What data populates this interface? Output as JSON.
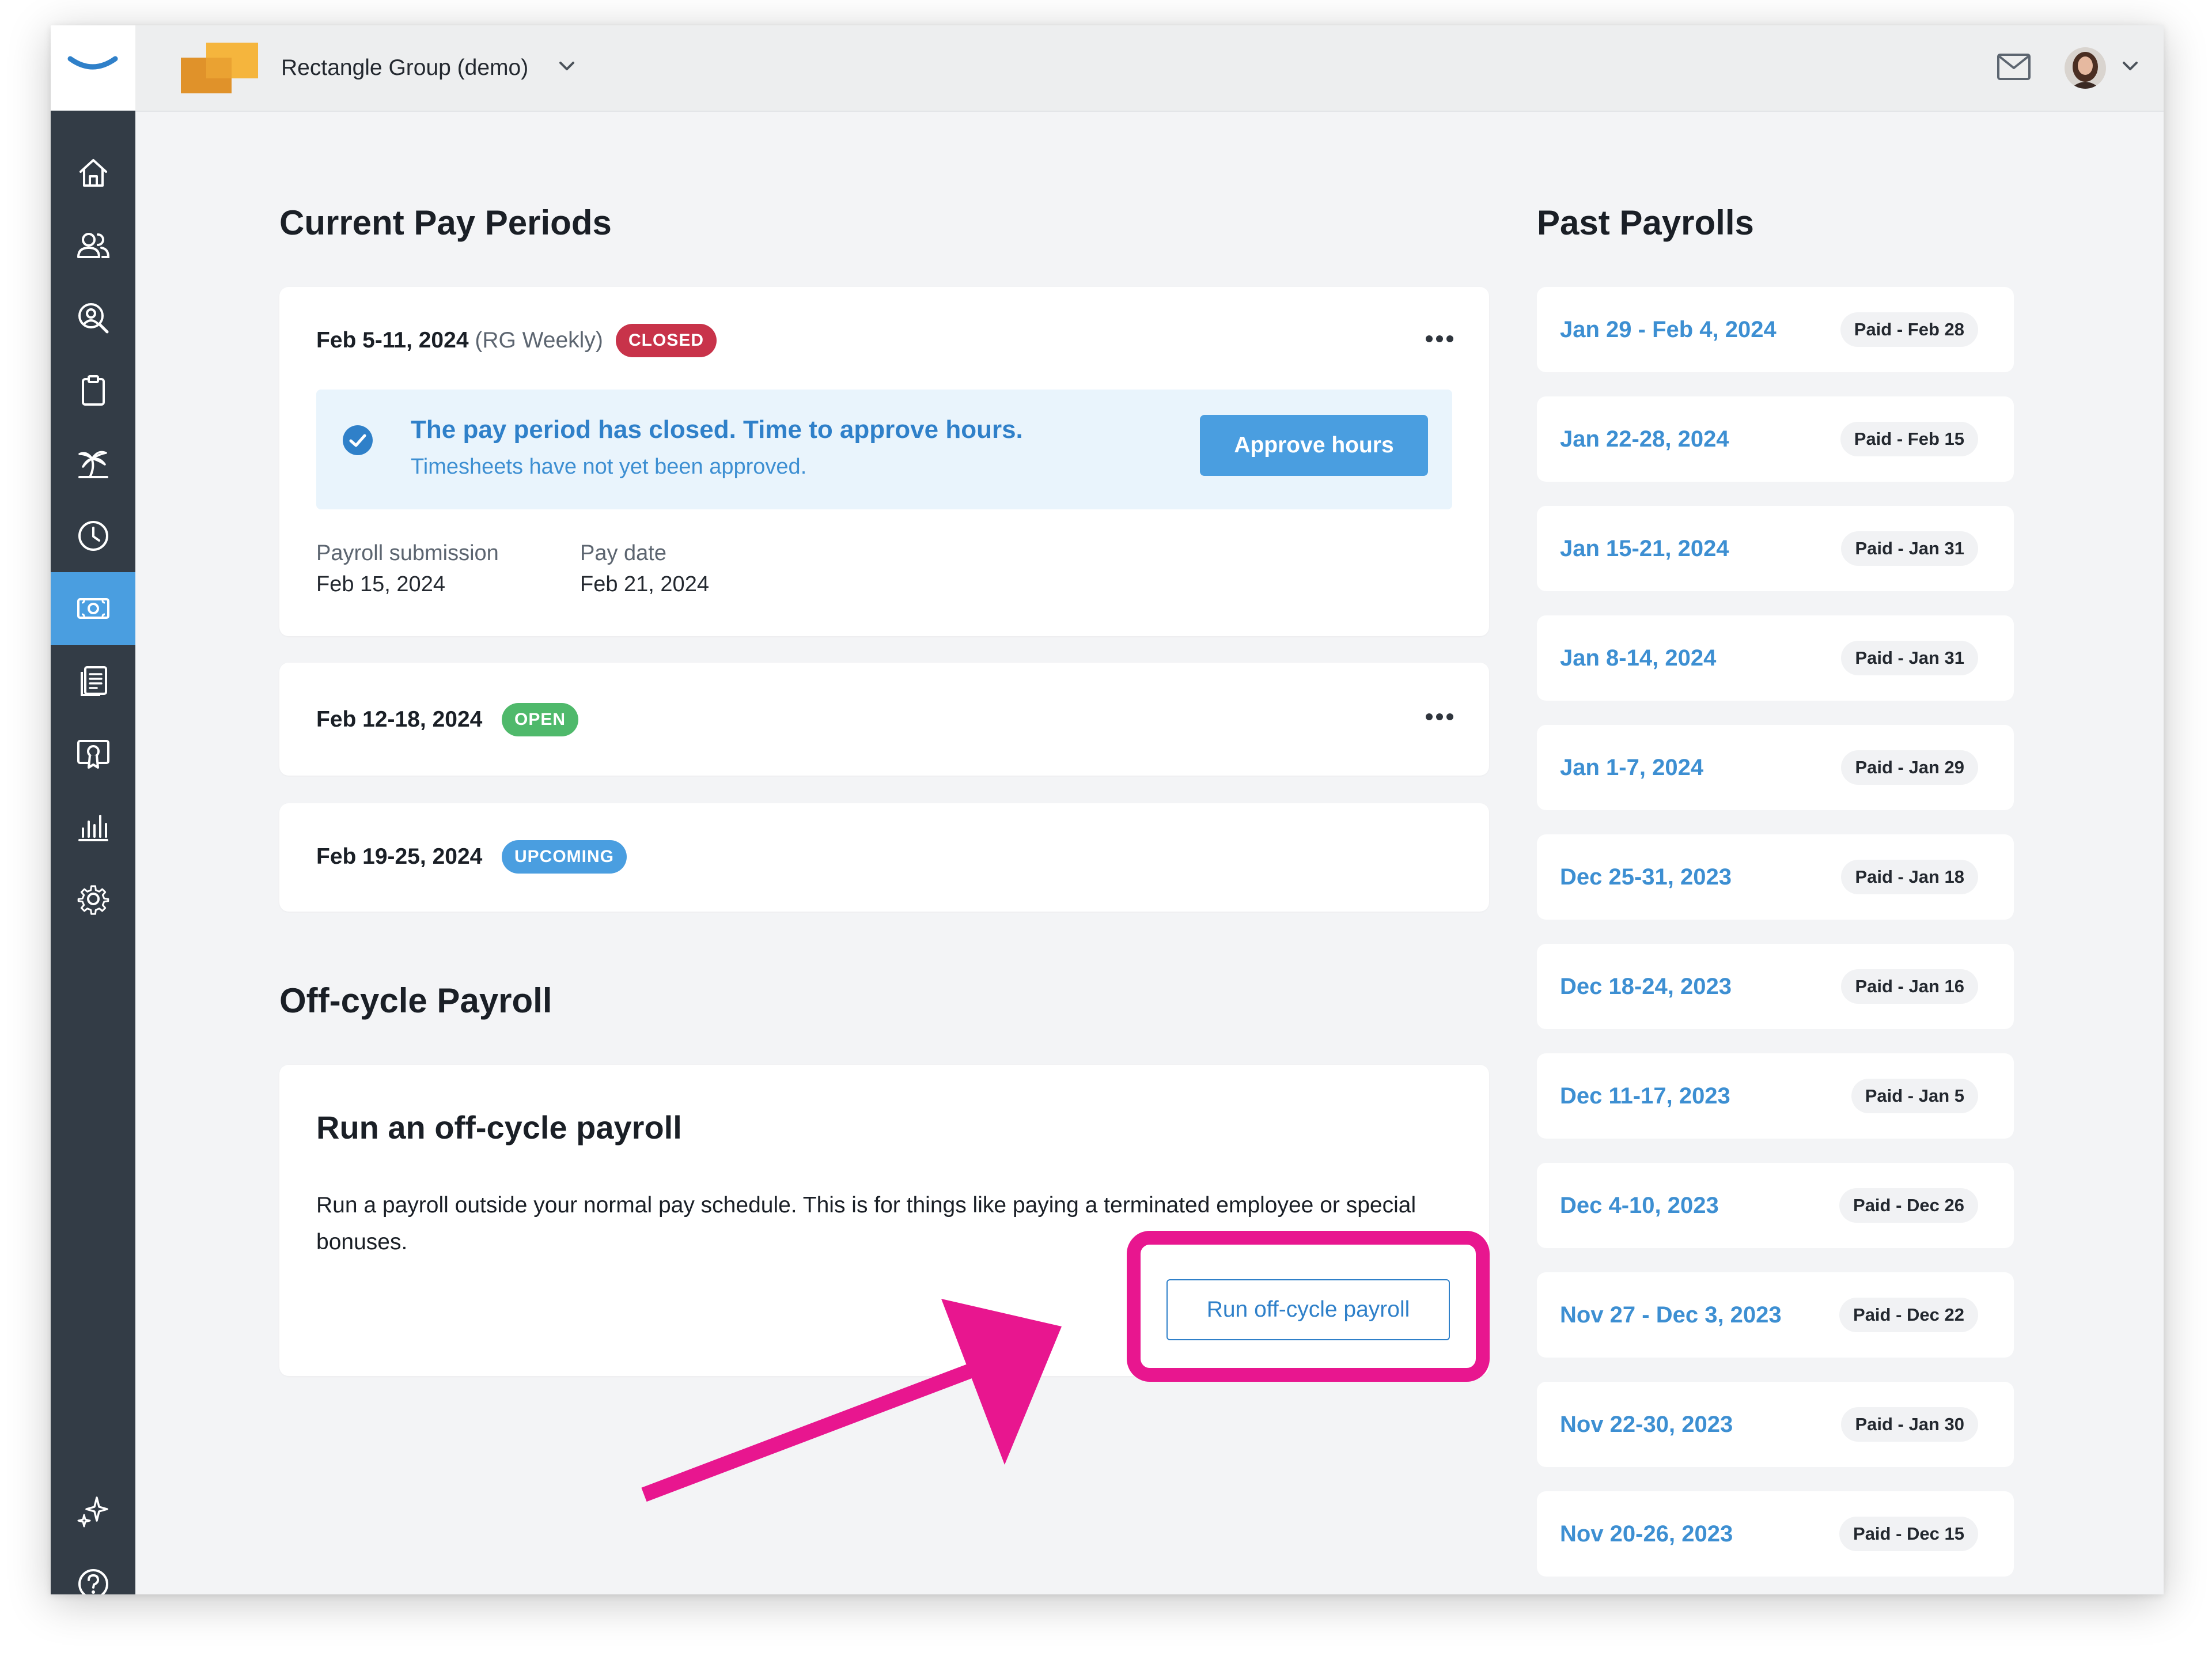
{
  "org": {
    "name": "Rectangle Group (demo)"
  },
  "colors": {
    "accent": "#4a9ee0",
    "link": "#3d8fd2",
    "closed": "#c8334a",
    "open": "#4fb96b",
    "upcoming": "#4a9ee0",
    "highlight": "#e8168f",
    "sidebar": "#333c46"
  },
  "sidebar": {
    "items": [
      {
        "icon": "home-icon"
      },
      {
        "icon": "people-icon"
      },
      {
        "icon": "person-search-icon"
      },
      {
        "icon": "clipboard-icon"
      },
      {
        "icon": "palm-tree-icon"
      },
      {
        "icon": "clock-icon"
      },
      {
        "icon": "payroll-money-icon",
        "active": true
      },
      {
        "icon": "documents-icon"
      },
      {
        "icon": "certificate-icon"
      },
      {
        "icon": "bar-chart-icon"
      },
      {
        "icon": "settings-gear-icon"
      },
      {
        "icon": "sparkle-icon"
      },
      {
        "icon": "help-icon"
      }
    ]
  },
  "current": {
    "title": "Current Pay Periods",
    "periods": [
      {
        "range": "Feb 5-11, 2024",
        "schedule": "(RG Weekly)",
        "status": "CLOSED",
        "notice": {
          "title": "The pay period has closed. Time to approve hours.",
          "subtitle": "Timesheets have not yet been approved.",
          "button": "Approve hours"
        },
        "submission_label": "Payroll submission",
        "submission_date": "Feb 15, 2024",
        "paydate_label": "Pay date",
        "paydate": "Feb 21, 2024"
      },
      {
        "range": "Feb 12-18, 2024",
        "status": "OPEN"
      },
      {
        "range": "Feb 19-25, 2024",
        "status": "UPCOMING"
      }
    ]
  },
  "offcycle": {
    "section_title": "Off-cycle Payroll",
    "title": "Run an off-cycle payroll",
    "description": "Run a payroll outside your normal pay schedule. This is for things like paying a terminated employee or special bonuses.",
    "button": "Run off-cycle payroll"
  },
  "past": {
    "title": "Past Payrolls",
    "items": [
      {
        "range": "Jan 29 - Feb 4, 2024",
        "paid": "Paid - Feb 28"
      },
      {
        "range": "Jan 22-28, 2024",
        "paid": "Paid - Feb 15"
      },
      {
        "range": "Jan 15-21, 2024",
        "paid": "Paid - Jan 31"
      },
      {
        "range": "Jan 8-14, 2024",
        "paid": "Paid - Jan 31"
      },
      {
        "range": "Jan 1-7, 2024",
        "paid": "Paid - Jan 29"
      },
      {
        "range": "Dec 25-31, 2023",
        "paid": "Paid - Jan 18"
      },
      {
        "range": "Dec 18-24, 2023",
        "paid": "Paid - Jan 16"
      },
      {
        "range": "Dec 11-17, 2023",
        "paid": "Paid - Jan 5"
      },
      {
        "range": "Dec 4-10, 2023",
        "paid": "Paid - Dec 26"
      },
      {
        "range": "Nov 27 - Dec 3, 2023",
        "paid": "Paid - Dec 22"
      },
      {
        "range": "Nov 22-30, 2023",
        "paid": "Paid - Jan 30"
      },
      {
        "range": "Nov 20-26, 2023",
        "paid": "Paid - Dec 15"
      }
    ]
  }
}
